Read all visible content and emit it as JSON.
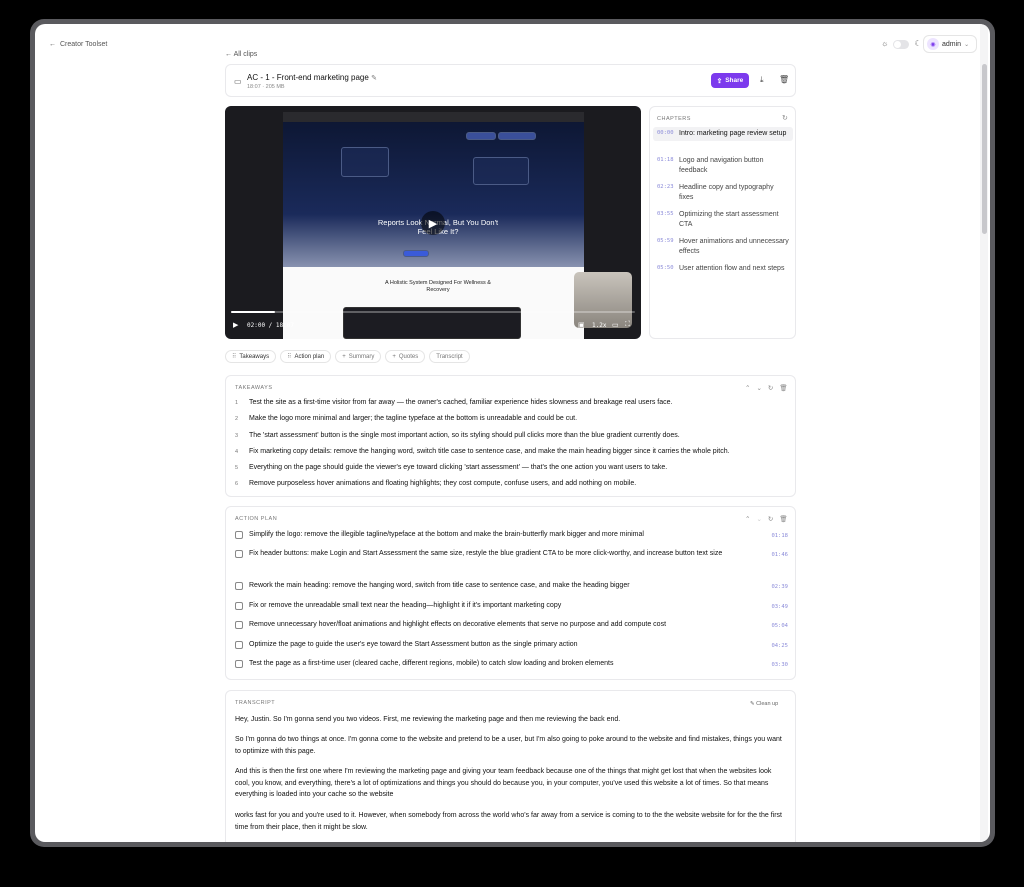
{
  "nav": {
    "back_label": "Creator Toolset",
    "all_clips": "All clips"
  },
  "user": {
    "name": "admin"
  },
  "clip": {
    "title": "AC - 1 - Front-end marketing page",
    "meta": "18:07 · 205 MB",
    "share_label": "Share"
  },
  "video": {
    "headline": "Reports Look Normal, But You Don't Feel Like It?",
    "subheadline": "A Holistic System Designed For Wellness & Recovery",
    "time": "02:00 / 18:07",
    "speed": "1.2x",
    "progress": 0.11
  },
  "chapters": {
    "label": "CHAPTERS",
    "items": [
      {
        "time": "00:00",
        "title": "Intro: marketing page review setup",
        "active": true
      },
      {
        "time": "01:18",
        "title": "Logo and navigation button feedback"
      },
      {
        "time": "02:23",
        "title": "Headline copy and typography fixes"
      },
      {
        "time": "03:55",
        "title": "Optimizing the start assessment CTA"
      },
      {
        "time": "05:59",
        "title": "Hover animations and unnecessary effects"
      },
      {
        "time": "05:50",
        "title": "User attention flow and next steps"
      }
    ]
  },
  "tabs": [
    {
      "label": "Takeaways",
      "prefix": "⠿"
    },
    {
      "label": "Action plan",
      "prefix": "⠿"
    },
    {
      "label": "Summary",
      "prefix": "+"
    },
    {
      "label": "Quotes",
      "prefix": "+"
    },
    {
      "label": "Transcript",
      "prefix": ""
    }
  ],
  "takeaways": {
    "label": "TAKEAWAYS",
    "items": [
      "Test the site as a first-time visitor from far away — the owner's cached, familiar experience hides slowness and breakage real users face.",
      "Make the logo more minimal and larger; the tagline typeface at the bottom is unreadable and could be cut.",
      "The 'start assessment' button is the single most important action, so its styling should pull clicks more than the blue gradient currently does.",
      "Fix marketing copy details: remove the hanging word, switch title case to sentence case, and make the main heading bigger since it carries the whole pitch.",
      "Everything on the page should guide the viewer's eye toward clicking 'start assessment' — that's the one action you want users to take.",
      "Remove purposeless hover animations and floating highlights; they cost compute, confuse users, and add nothing on mobile."
    ]
  },
  "action_plan": {
    "label": "ACTION PLAN",
    "items": [
      {
        "text": "Simplify the logo: remove the illegible tagline/typeface at the bottom and make the brain-butterfly mark bigger and more minimal",
        "time": "01:18"
      },
      {
        "text": "Fix header buttons: make Login and Start Assessment the same size, restyle the blue gradient CTA to be more click-worthy, and increase button text size",
        "time": "01:46"
      },
      {
        "text": "Rework the main heading: remove the hanging word, switch from title case to sentence case, and make the heading bigger",
        "time": "02:39"
      },
      {
        "text": "Fix or remove the unreadable small text near the heading—highlight it if it's important marketing copy",
        "time": "03:49"
      },
      {
        "text": "Remove unnecessary hover/float animations and highlight effects on decorative elements that serve no purpose and add compute cost",
        "time": "05:04"
      },
      {
        "text": "Optimize the page to guide the user's eye toward the Start Assessment button as the single primary action",
        "time": "04:25"
      },
      {
        "text": "Test the page as a first-time user (cleared cache, different regions, mobile) to catch slow loading and broken elements",
        "time": "03:30"
      }
    ]
  },
  "transcript": {
    "label": "TRANSCRIPT",
    "cleanup_label": "Clean up",
    "paragraphs": [
      "Hey, Justin. So I'm gonna send you two videos. First, me reviewing the marketing page and then me reviewing the back end.",
      "So I'm gonna do two things at once. I'm gonna come to the website and pretend to be a user, but I'm also going to poke around to the website and find mistakes, things you want to optimize with this page.",
      "And this is then the first one where I'm reviewing the marketing page and giving your team feedback because one of the things that might get lost that when the websites look cool, you know, and everything, there's a lot of optimizations and things you should do because you, in your computer, you've used this website a lot of times. So that means everything is loaded into your cache so the website",
      "works fast for you and you're used to it. However, when somebody from across the world who's far away from a service is coming to to the the website website for for the the first time from their place, then it might be slow."
    ]
  }
}
